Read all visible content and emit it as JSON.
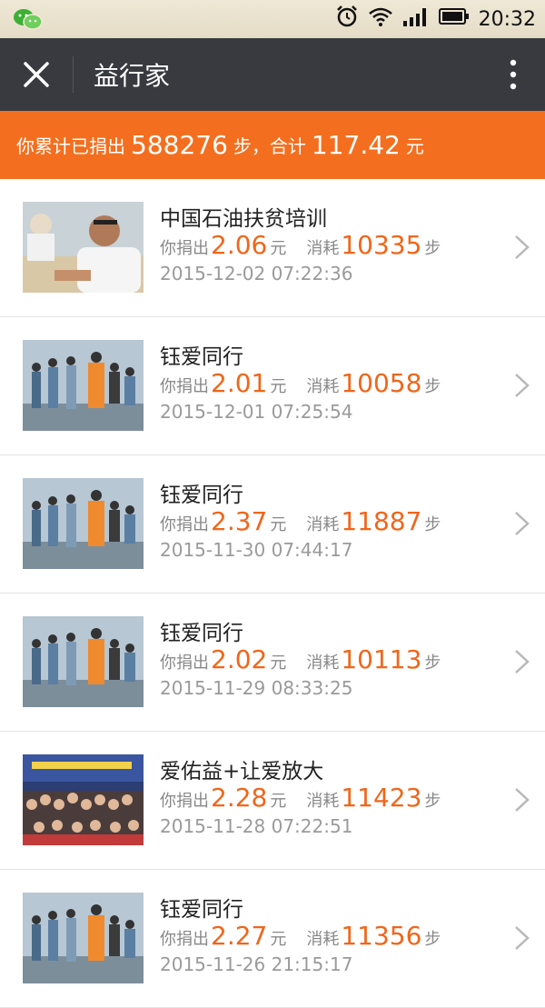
{
  "status_bar": {
    "time": "20:32",
    "icons": [
      "wechat-icon",
      "alarm-icon",
      "wifi-icon",
      "signal-icon",
      "battery-icon"
    ]
  },
  "app_bar": {
    "title": "益行家",
    "icons": [
      "close-icon",
      "more-vertical-icon"
    ]
  },
  "summary": {
    "prefix": "你累计已捐出",
    "steps": "588276",
    "steps_unit": "步，合计",
    "amount": "117.42",
    "amount_unit": "元"
  },
  "labels": {
    "donated": "你捐出",
    "yuan": "元",
    "consumed": "消耗",
    "steps": "步"
  },
  "colors": {
    "accent": "#f36f1f",
    "appbar": "#393a3f",
    "number": "#f0661a"
  },
  "items": [
    {
      "title": "中国石油扶贫培训",
      "amount": "2.06",
      "steps": "10335",
      "date": "2015-12-02 07:22:36",
      "thumb": "training-photo"
    },
    {
      "title": "钰爱同行",
      "amount": "2.01",
      "steps": "10058",
      "date": "2015-12-01 07:25:54",
      "thumb": "children-photo"
    },
    {
      "title": "钰爱同行",
      "amount": "2.37",
      "steps": "11887",
      "date": "2015-11-30 07:44:17",
      "thumb": "children-photo"
    },
    {
      "title": "钰爱同行",
      "amount": "2.02",
      "steps": "10113",
      "date": "2015-11-29 08:33:25",
      "thumb": "children-photo"
    },
    {
      "title": "爱佑益+让爱放大",
      "amount": "2.28",
      "steps": "11423",
      "date": "2015-11-28 07:22:51",
      "thumb": "group-photo"
    },
    {
      "title": "钰爱同行",
      "amount": "2.27",
      "steps": "11356",
      "date": "2015-11-26 21:15:17",
      "thumb": "children-photo"
    }
  ]
}
